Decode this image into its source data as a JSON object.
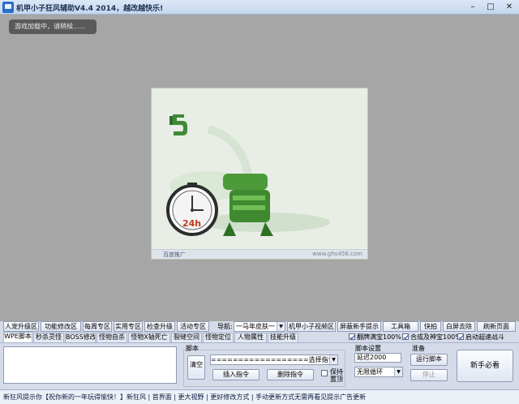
{
  "window": {
    "title": "机甲小子狂风辅助V4.4  2014，越改越快乐!",
    "buttons": {
      "minimize": "–",
      "maximize": "□",
      "close": "✕"
    }
  },
  "game": {
    "loading_text": "游戏加载中，请稍候......",
    "ad": {
      "footer_label": "百度推广",
      "url": "www.ghs456.com",
      "clock_text": "24h"
    }
  },
  "nav": {
    "buttons": [
      "人宠升级区",
      "功能修改区",
      "每周专区",
      "实用专区",
      "检查升级",
      "活动专区"
    ],
    "label": "导航:",
    "skin_selected": "一马年皮肤一",
    "right_buttons": [
      "机甲小子视频区",
      "屏蔽新手提示",
      "工具箱",
      "快拍",
      "白屏去除",
      "刷新页面"
    ]
  },
  "tabs": [
    "WPE脚本",
    "秒杀灵怪",
    "BOSS修改",
    "怪物自杀",
    "怪物X轴死亡",
    "裂缝空间",
    "怪物定位",
    "人物属性",
    "技能升级"
  ],
  "options": {
    "items": [
      {
        "label": "翻牌满宝100%",
        "checked": true
      },
      {
        "label": "合成及神宝100%",
        "checked": true
      },
      {
        "label": "启动超速战斗",
        "checked": true
      }
    ]
  },
  "script": {
    "legend": "脚本",
    "clear_label": "清空",
    "command_select": "==================选择指令=================",
    "insert_label": "插入指令",
    "delete_label": "删除指令",
    "ontop_label": "保持置顶",
    "ontop_checked": false
  },
  "settings": {
    "legend": "脚本设置",
    "delay": "延迟2000",
    "loop": "无限循环"
  },
  "ready": {
    "legend": "准备",
    "run_label": "运行脚本",
    "stop_label": "停止"
  },
  "newbie_label": "新手必看",
  "ticker": "新狂风提示你【祝你新的一年玩得愉快！】新狂风 | 首界面 | 更大视野 | 更好修改方式 | 手动更新方式无需再看见提示广告更新"
}
